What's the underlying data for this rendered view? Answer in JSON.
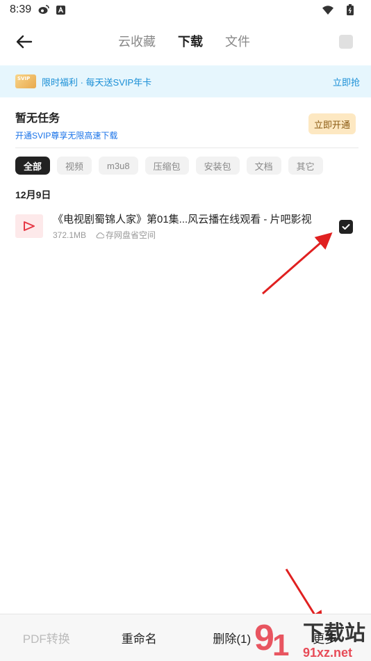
{
  "status_bar": {
    "time": "8:39",
    "left_icons": [
      "weibo-icon",
      "app-a-icon"
    ],
    "right_icons": [
      "wifi-icon",
      "battery-icon"
    ]
  },
  "top_nav": {
    "tabs": [
      {
        "label": "云收藏",
        "active": false
      },
      {
        "label": "下载",
        "active": true
      },
      {
        "label": "文件",
        "active": false
      }
    ]
  },
  "promo_banner": {
    "card_text": "SVIP",
    "text": "限时福利 · 每天送SVIP年卡",
    "action_label": "立即抢"
  },
  "task_section": {
    "title": "暂无任务",
    "subtitle": "开通SVIP尊享无限高速下载",
    "button_label": "立即开通"
  },
  "filters": [
    {
      "label": "全部",
      "active": true
    },
    {
      "label": "视频",
      "active": false
    },
    {
      "label": "m3u8",
      "active": false
    },
    {
      "label": "压缩包",
      "active": false
    },
    {
      "label": "安装包",
      "active": false
    },
    {
      "label": "文档",
      "active": false
    },
    {
      "label": "其它",
      "active": false
    }
  ],
  "date_group": "12月9日",
  "files": [
    {
      "name": "《电视剧蜀锦人家》第01集...风云播在线观看 - 片吧影视",
      "size": "372.1MB",
      "storage_hint": "存网盘省空间",
      "checked": true
    }
  ],
  "bottom_bar": {
    "pdf_label": "PDF转换",
    "rename_label": "重命名",
    "delete_label": "删除(1)",
    "more_label": "更多"
  },
  "watermark": {
    "text_top": "下载站",
    "text_bottom": "91xz.net"
  },
  "colors": {
    "accent_blue": "#1a8fd6",
    "link_blue": "#1a73e8",
    "promo_bg": "#e6f6fd",
    "open_btn_bg": "#fde8c2",
    "arrow_red": "#e02020"
  }
}
